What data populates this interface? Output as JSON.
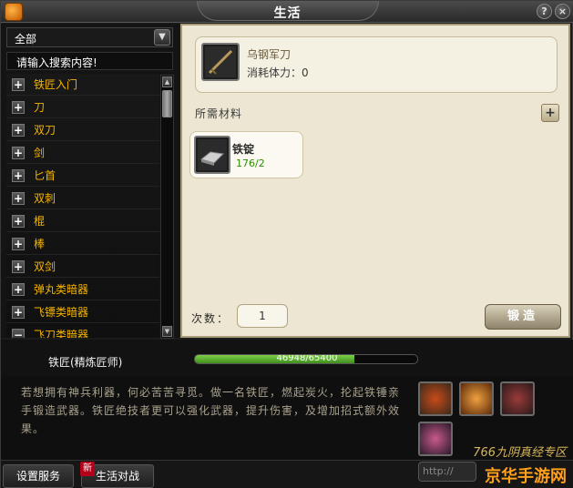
{
  "window": {
    "title": "生活",
    "help_symbol": "?",
    "close_symbol": "×"
  },
  "left": {
    "filter_value": "全部",
    "search_placeholder": "请输入搜索内容!",
    "items": [
      {
        "label": "铁匠入门"
      },
      {
        "label": "刀"
      },
      {
        "label": "双刀"
      },
      {
        "label": "剑"
      },
      {
        "label": "匕首"
      },
      {
        "label": "双刺"
      },
      {
        "label": "棍"
      },
      {
        "label": "棒"
      },
      {
        "label": "双剑"
      },
      {
        "label": "弹丸类暗器"
      },
      {
        "label": "飞镖类暗器"
      },
      {
        "label": "飞刀类暗器"
      }
    ]
  },
  "recipe": {
    "name": "乌钢军刀",
    "cost_text": "消耗体力：0"
  },
  "materials": {
    "section_label": "所需材料",
    "add_symbol": "+",
    "items": [
      {
        "name": "铁锭",
        "count": "176/2"
      }
    ]
  },
  "craft": {
    "count_label": "次数：",
    "count_value": "1",
    "forge_label": "锻造"
  },
  "profession": {
    "name": "铁匠(精炼匠师)",
    "exp_text": "46948/65400",
    "exp_progress": 0.718
  },
  "description": {
    "text": "若想拥有神兵利器，何必苦苦寻觅。做一名铁匠，燃起炭火，抡起铁锤亲手锻造武器。铁匠绝技者更可以强化武器，提升伤害，及增加招式额外效果。"
  },
  "bottom": {
    "settings_label": "设置服务",
    "life_battle_label": "生活对战",
    "new_badge": "新",
    "watermark_small": "766九阴真经专区",
    "watermark_large": "京华手游网",
    "right_pill_text": "http://"
  },
  "colors": {
    "category_text": "#f4b400",
    "material_count": "#2e8b00",
    "exp_fill": "#5fb032"
  }
}
